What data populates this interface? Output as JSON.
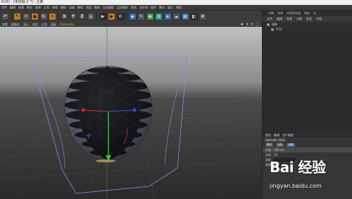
{
  "window": {
    "title": "R19) - [未标题 2 *] - 主要"
  },
  "menubar": {
    "items": [
      "文件",
      "编辑",
      "创建",
      "模式",
      "选择",
      "工具",
      "网格",
      "捕捉",
      "动画",
      "模拟",
      "渲染",
      "雕刻",
      "运动跟踪",
      "运动图形",
      "角色",
      "流水线",
      "插件",
      "脚本",
      "窗口",
      "帮助"
    ]
  },
  "toolbar": {
    "axis_x": "X",
    "axis_y": "Y",
    "axis_z": "Z",
    "colors": {
      "orange": "#c57c1c",
      "blue": "#2f6fb8",
      "teal": "#2a9a8c",
      "green": "#3f9a3a"
    }
  },
  "viewport_menu": {
    "items": [
      "查看",
      "摄像机",
      "显示",
      "选项",
      "过滤",
      "面板"
    ],
    "active": "ProRender"
  },
  "viewport": {
    "background_top": "#b9b9b9",
    "background_bottom": "#2d2d2d",
    "mesh_color": "#5b6170",
    "bbox_color": "#8a8af0"
  },
  "object_manager": {
    "tabs": [
      "对象",
      "场景",
      "内容浏览器",
      "构造",
      "层"
    ],
    "active_tab": "层",
    "menu": [
      "文件",
      "编辑",
      "查看",
      "对象",
      "标签",
      "书签"
    ],
    "rows": [
      {
        "name": "球体"
      },
      {
        "name": "FFD"
      }
    ]
  },
  "attributes": {
    "tabs": [
      "模式",
      "编辑",
      "用户数据"
    ],
    "title": "球体对象 [球体]",
    "pills": [
      "基本",
      "坐标",
      "对象"
    ],
    "rows": [
      {
        "label": "半径",
        "value": "100 cm"
      },
      {
        "label": "分段",
        "value": "24"
      },
      {
        "label": "类型",
        "value": "标准"
      },
      {
        "label": "理想渲染",
        "value": ""
      }
    ]
  },
  "watermark": {
    "logo": "Bai 经验",
    "url": "jingyan.baidu.com"
  }
}
